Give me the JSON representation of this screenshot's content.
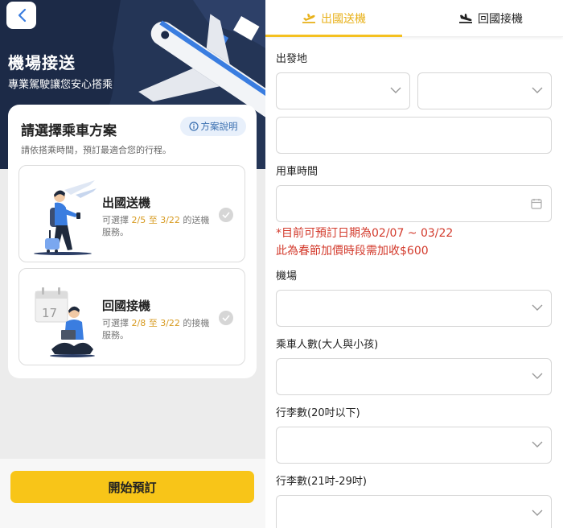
{
  "left": {
    "hero": {
      "title": "機場接送",
      "subtitle": "專業駕駛讓您安心搭乘"
    },
    "plan": {
      "title": "請選擇乘車方案",
      "help_label": "方案說明",
      "description": "請依搭乘時間，預訂最適合您的行程。",
      "options": [
        {
          "title": "出國送機",
          "desc_prefix": "可選擇 ",
          "date_from": "2/5",
          "connector": " 至 ",
          "date_to": "3/22",
          "desc_suffix": " 的送機服務。"
        },
        {
          "title": "回國接機",
          "desc_prefix": "可選擇 ",
          "date_from": "2/8",
          "connector": " 至 ",
          "date_to": "3/22",
          "desc_suffix": " 的接機服務。"
        }
      ],
      "calendar_day": "17"
    },
    "start_button": "開始預訂"
  },
  "right": {
    "tabs": [
      {
        "label": "出國送機",
        "active": true
      },
      {
        "label": "回國接機",
        "active": false
      }
    ],
    "fields": {
      "origin_label": "出發地",
      "time_label": "用車時間",
      "airport_label": "機場",
      "passengers_label": "乘車人數(大人與小孩)",
      "luggage20_label": "行李數(20吋以下)",
      "luggage29_label": "行李數(21吋-29吋)"
    },
    "notice": [
      "*目前可預訂日期為02/07 ~ 03/22",
      "此為春節加價時段需加收$600"
    ]
  },
  "colors": {
    "accent": "#f8c518",
    "tab_active": "#e8b11a",
    "warning": "#d33a2c",
    "hero_bg": "#1c2a47",
    "date_highlight": "#d79a1f"
  }
}
